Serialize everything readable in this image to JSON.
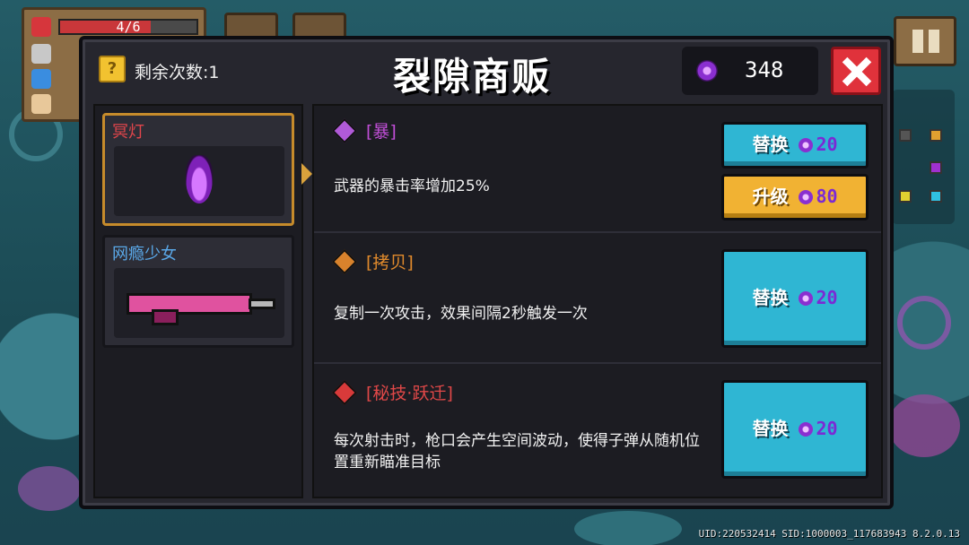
{
  "hud": {
    "hp_text": "4/6",
    "hp_fraction": 0.667
  },
  "shop": {
    "title": "裂隙商贩",
    "remaining_label": "剩余次数:1",
    "gems": "348",
    "colors": {
      "replace": "#2fb6d3",
      "upgrade": "#f1b233",
      "close": "#e0323b"
    }
  },
  "weapons": [
    {
      "name": "冥灯",
      "name_color": "#e0454b",
      "selected": true,
      "icon": "dark-lantern-icon"
    },
    {
      "name": "网瘾少女",
      "name_color": "#5aa8e8",
      "selected": false,
      "icon": "pink-rifle-icon"
    }
  ],
  "items": [
    {
      "name": "[暴]",
      "name_color": "#c24fd8",
      "icon_color": "#b05ad8",
      "icon": "purple-gem-icon",
      "desc": "武器的暴击率增加25%",
      "buttons": [
        {
          "label": "替换",
          "cost": "20"
        },
        {
          "label": "升级",
          "cost": "80"
        }
      ]
    },
    {
      "name": "[拷贝]",
      "name_color": "#e08a2c",
      "icon_color": "#d8822c",
      "icon": "orange-gem-icon",
      "desc": "复制一次攻击，效果间隔2秒触发一次",
      "buttons": [
        {
          "label": "替换",
          "cost": "20"
        }
      ]
    },
    {
      "name": "[秘技·跃迁]",
      "name_color": "#e04848",
      "icon_color": "#d83a3a",
      "icon": "red-gem-icon",
      "desc": "每次射击时，枪口会产生空间波动，使得子弹从随机位置重新瞄准目标",
      "buttons": [
        {
          "label": "替换",
          "cost": "20"
        }
      ]
    }
  ],
  "footer": {
    "uid": "UID:220532414 SID:1000003_117683943 8.2.0.13"
  }
}
